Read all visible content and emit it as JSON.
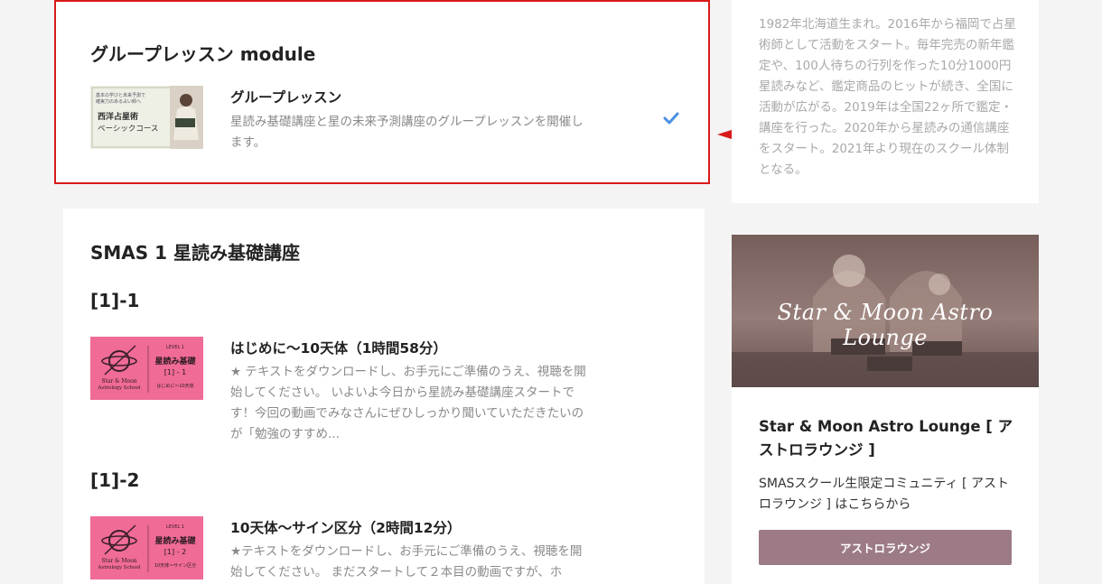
{
  "module": {
    "title": "グループレッスン module",
    "item": {
      "title": "グループレッスン",
      "description": "星読み基礎講座と星の未来予測講座のグループレッスンを開催します。",
      "thumbnail": {
        "line1": "基本の学びと未来予測で",
        "line2": "確実力のある占い師へ",
        "course": "西洋占星術",
        "course2": "ベーシックコース"
      }
    }
  },
  "section": {
    "title": "SMAS 1 星読み基礎講座",
    "lessons": [
      {
        "number": "[1]-1",
        "title": "はじめに〜10天体（1時間58分）",
        "description": "★ テキストをダウンロードし、お手元にご準備のうえ、視聴を開始してください。 いよいよ今日から星読み基礎講座スタートです！今回の動画でみなさんにぜひしっかり聞いていただきたいのが「勉強のすすめ...",
        "thumb": {
          "school": "Star & Moon",
          "school2": "Astrology School",
          "level": "LEVEL 1",
          "name": "星読み基礎",
          "code": "[1] - 1",
          "sub": "はじめに〜10天体"
        }
      },
      {
        "number": "[1]-2",
        "title": "10天体〜サイン区分（2時間12分）",
        "description": "★テキストをダウンロードし、お手元にご準備のうえ、視聴を開始してください。 まだスタートして２本目の動画ですが、ホ",
        "thumb": {
          "school": "Star & Moon",
          "school2": "Astrology School",
          "level": "LEVEL 1",
          "name": "星読み基礎",
          "code": "[1] - 2",
          "sub": "10天体〜サイン区分"
        }
      }
    ]
  },
  "profile": {
    "text": "1982年北海道生まれ。2016年から福岡で占星術師として活動をスタート。毎年完売の新年鑑定や、100人待ちの行列を作った10分1000円星読みなど、鑑定商品のヒットが続き、全国に活動が広がる。2019年は全国22ヶ所で鑑定・講座を行った。2020年から星読みの通信講座をスタート。2021年より現在のスクール体制となる。"
  },
  "lounge": {
    "image_text": "Star & Moon Astro Lounge",
    "title": "Star & Moon Astro Lounge [ アストロラウンジ ]",
    "description": "SMASスクール生限定コミュニティ [ アストロラウンジ ] はこちらから",
    "button_label": "アストロラウンジ"
  },
  "colors": {
    "highlight_border": "#d81a1a",
    "arrow": "#d81a1a",
    "check": "#4a90e2",
    "button": "#9c7b86",
    "thumb_pink": "#f06b96"
  }
}
